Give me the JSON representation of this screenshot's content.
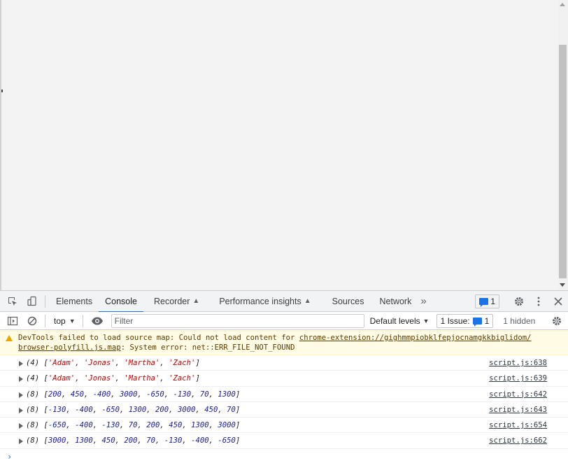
{
  "devtools": {
    "tabs": [
      {
        "label": "Elements",
        "active": false,
        "experimental": false
      },
      {
        "label": "Console",
        "active": true,
        "experimental": false
      },
      {
        "label": "Recorder",
        "active": false,
        "experimental": true
      },
      {
        "label": "Performance insights",
        "active": false,
        "experimental": true
      },
      {
        "label": "Sources",
        "active": false,
        "experimental": false
      },
      {
        "label": "Network",
        "active": false,
        "experimental": false
      }
    ],
    "more_tabs": "»",
    "issues_count": "1"
  },
  "toolbar": {
    "context": "top",
    "filter_placeholder": "Filter",
    "levels_label": "Default levels",
    "issue_label": "1 Issue:",
    "issue_count": "1",
    "hidden_label": "1 hidden"
  },
  "console": {
    "warning": {
      "prefix": "DevTools failed to load source map: Could not load content for ",
      "url_line1": "chrome-extension://gighmmpiobklfepjocnamgkkbiglidom/",
      "url_line2": "browser-polyfill.js.map",
      "suffix": ": System error: net::ERR_FILE_NOT_FOUND"
    },
    "rows": [
      {
        "count": "(4)",
        "kind": "strings",
        "items": [
          "'Adam'",
          "'Jonas'",
          "'Martha'",
          "'Zach'"
        ],
        "source": "script.js:638"
      },
      {
        "count": "(4)",
        "kind": "strings",
        "items": [
          "'Adam'",
          "'Jonas'",
          "'Martha'",
          "'Zach'"
        ],
        "source": "script.js:639"
      },
      {
        "count": "(8)",
        "kind": "numbers",
        "items": [
          "200",
          "450",
          "-400",
          "3000",
          "-650",
          "-130",
          "70",
          "1300"
        ],
        "source": "script.js:642"
      },
      {
        "count": "(8)",
        "kind": "numbers",
        "items": [
          "-130",
          "-400",
          "-650",
          "1300",
          "200",
          "3000",
          "450",
          "70"
        ],
        "source": "script.js:643"
      },
      {
        "count": "(8)",
        "kind": "numbers",
        "items": [
          "-650",
          "-400",
          "-130",
          "70",
          "200",
          "450",
          "1300",
          "3000"
        ],
        "source": "script.js:654"
      },
      {
        "count": "(8)",
        "kind": "numbers",
        "items": [
          "3000",
          "1300",
          "450",
          "200",
          "70",
          "-130",
          "-400",
          "-650"
        ],
        "source": "script.js:662"
      }
    ],
    "prompt": "›"
  },
  "icons": {
    "inspect": "inspect-element-icon",
    "device": "device-toolbar-icon",
    "settings": "gear-icon",
    "menu": "kebab-menu-icon",
    "close": "close-icon",
    "sidebar": "sidebar-toggle-icon",
    "clear": "clear-console-icon",
    "eye": "live-expression-icon"
  },
  "colors": {
    "accent": "#1a73e8",
    "warning_bg": "#fffbe5",
    "string": "#c80000",
    "number": "#1a1aa6"
  }
}
